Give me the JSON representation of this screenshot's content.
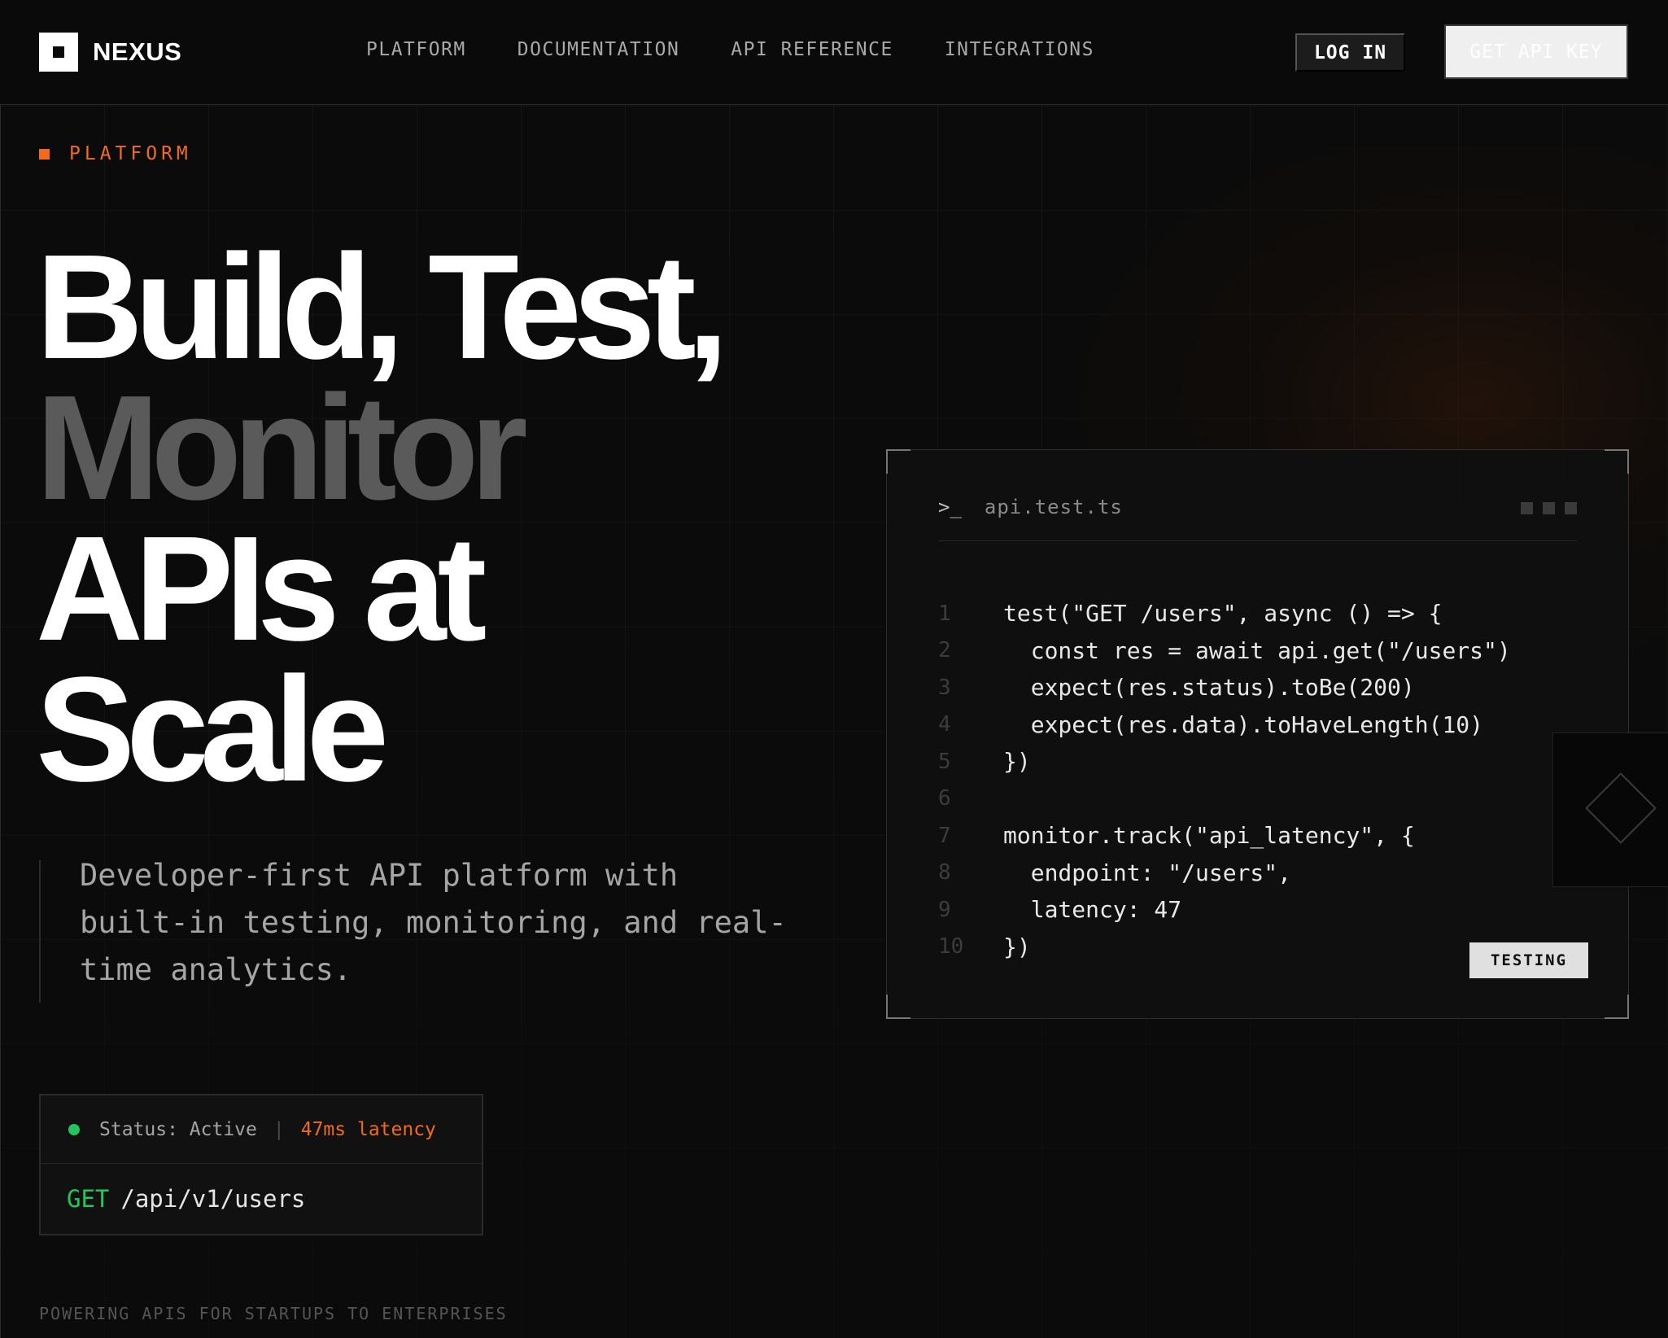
{
  "brand": {
    "name": "NEXUS"
  },
  "nav": {
    "links": [
      "PLATFORM",
      "DOCUMENTATION",
      "API REFERENCE",
      "INTEGRATIONS"
    ],
    "login_label": "LOG IN",
    "api_key_label": "GET API KEY"
  },
  "hero": {
    "eyebrow": "PLATFORM",
    "headline": [
      "Build, Test,",
      "Monitor",
      "APIs at",
      "Scale"
    ],
    "description": "Developer-first API platform with built-in testing, monitoring, and real-time analytics."
  },
  "status_card": {
    "status": "Status: Active",
    "separator": "|",
    "latency": "47ms latency",
    "method": "GET",
    "path": "/api/v1/users"
  },
  "code_panel": {
    "prompt": ">_",
    "filename": "api.test.ts",
    "badge": "TESTING",
    "lines": [
      {
        "n": "1",
        "code": "test(\"GET /users\", async () => {"
      },
      {
        "n": "2",
        "code": "  const res = await api.get(\"/users\")"
      },
      {
        "n": "3",
        "code": "  expect(res.status).toBe(200)"
      },
      {
        "n": "4",
        "code": "  expect(res.data).toHaveLength(10)"
      },
      {
        "n": "5",
        "code": "})"
      },
      {
        "n": "6",
        "code": ""
      },
      {
        "n": "7",
        "code": "monitor.track(\"api_latency\", {"
      },
      {
        "n": "8",
        "code": "  endpoint: \"/users\","
      },
      {
        "n": "9",
        "code": "  latency: 47"
      },
      {
        "n": "10",
        "code": "})"
      }
    ]
  },
  "footer": {
    "powering": "POWERING APIS FOR STARTUPS TO ENTERPRISES"
  },
  "colors": {
    "accent": "#f26b1d",
    "success": "#22c55e",
    "background": "#0b0b0b"
  }
}
